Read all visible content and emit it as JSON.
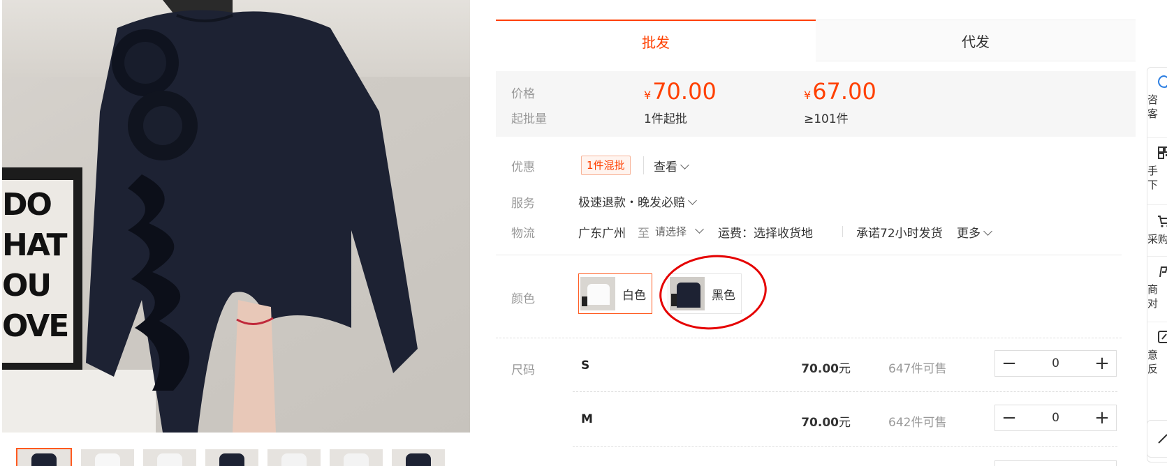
{
  "tabs": {
    "wholesale": "批发",
    "dropship": "代发"
  },
  "price_box": {
    "price_label": "价格",
    "moq_label": "起批量",
    "currency": "¥",
    "tiers": [
      {
        "price": "70.00",
        "moq": "1件起批"
      },
      {
        "price": "67.00",
        "moq": "≥101件"
      }
    ]
  },
  "promo": {
    "label": "优惠",
    "tag": "1件混批",
    "view": "查看"
  },
  "service": {
    "label": "服务",
    "value": "极速退款・晚发必赔"
  },
  "logistics": {
    "label": "物流",
    "from": "广东广州",
    "to_word": "至",
    "select": "请选择",
    "freight": "运费：选择收货地",
    "promise": "承诺72小时发货",
    "more": "更多"
  },
  "color": {
    "label": "颜色",
    "options": [
      {
        "name": "白色",
        "selected": true
      },
      {
        "name": "黑色",
        "selected": false
      }
    ]
  },
  "sizes": {
    "label": "尺码",
    "rows": [
      {
        "size": "S",
        "price": "70.00",
        "unit": "元",
        "stock": "647件可售",
        "qty": "0"
      },
      {
        "size": "M",
        "price": "70.00",
        "unit": "元",
        "stock": "642件可售",
        "qty": "0"
      }
    ]
  },
  "stepper": {
    "minus": "−",
    "plus": "+"
  },
  "sidebar": {
    "items": [
      {
        "line1": "咨",
        "line2": "客",
        "icon": "chat-icon"
      },
      {
        "line1": "手",
        "line2": "下",
        "icon": "qrcode-icon"
      },
      {
        "line1": "采购",
        "line2": "",
        "icon": "cart-icon"
      },
      {
        "line1": "商",
        "line2": "对",
        "icon": "compare-icon"
      },
      {
        "line1": "意",
        "line2": "反",
        "icon": "feedback-icon"
      }
    ]
  },
  "poster_text": "DO\nHAT\nOU\nOVE",
  "colors": {
    "accent": "#ff4000",
    "annotation": "#e50000"
  }
}
